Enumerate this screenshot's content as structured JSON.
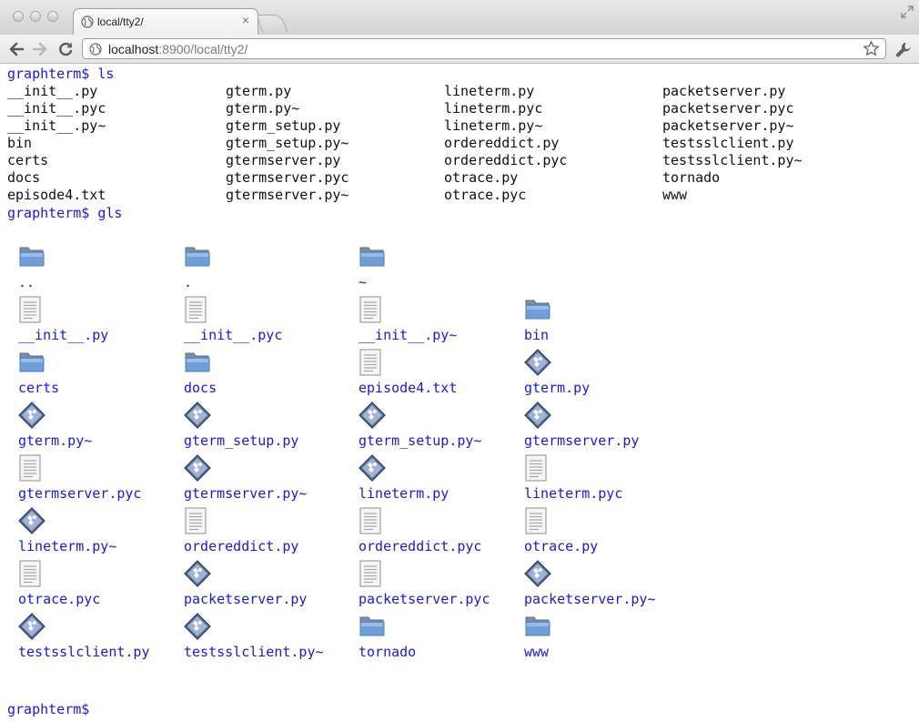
{
  "browser": {
    "tab_title": "local/tty2/",
    "url_host": "localhost",
    "url_path": ":8900/local/tty2/"
  },
  "terminal": {
    "prompt1": "graphterm$ ls",
    "ls_columns": [
      [
        "__init__.py",
        "__init__.pyc",
        "__init__.py~",
        "bin",
        "certs",
        "docs",
        "episode4.txt"
      ],
      [
        "gterm.py",
        "gterm.py~",
        "gterm_setup.py",
        "gterm_setup.py~",
        "gtermserver.py",
        "gtermserver.pyc",
        "gtermserver.py~"
      ],
      [
        "lineterm.py",
        "lineterm.pyc",
        "lineterm.py~",
        "ordereddict.py",
        "ordereddict.pyc",
        "otrace.py",
        "otrace.pyc"
      ],
      [
        "packetserver.py",
        "packetserver.pyc",
        "packetserver.py~",
        "testsslclient.py",
        "testsslclient.py~",
        "tornado",
        "www"
      ]
    ],
    "prompt2": "graphterm$ gls",
    "gls_rows": [
      [
        {
          "name": "..",
          "icon": "folder-icon"
        },
        {
          "name": ".",
          "icon": "folder-icon"
        },
        {
          "name": "~",
          "icon": "folder-icon"
        }
      ],
      [
        {
          "name": "__init__.py",
          "icon": "text-file-icon"
        },
        {
          "name": "__init__.pyc",
          "icon": "text-file-icon"
        },
        {
          "name": "__init__.py~",
          "icon": "text-file-icon"
        },
        {
          "name": "bin",
          "icon": "folder-icon"
        }
      ],
      [
        {
          "name": "certs",
          "icon": "folder-icon"
        },
        {
          "name": "docs",
          "icon": "folder-icon"
        },
        {
          "name": "episode4.txt",
          "icon": "text-file-icon"
        },
        {
          "name": "gterm.py",
          "icon": "script-icon"
        }
      ],
      [
        {
          "name": "gterm.py~",
          "icon": "script-icon"
        },
        {
          "name": "gterm_setup.py",
          "icon": "script-icon"
        },
        {
          "name": "gterm_setup.py~",
          "icon": "script-icon"
        },
        {
          "name": "gtermserver.py",
          "icon": "script-icon"
        }
      ],
      [
        {
          "name": "gtermserver.pyc",
          "icon": "text-file-icon"
        },
        {
          "name": "gtermserver.py~",
          "icon": "script-icon"
        },
        {
          "name": "lineterm.py",
          "icon": "script-icon"
        },
        {
          "name": "lineterm.pyc",
          "icon": "text-file-icon"
        }
      ],
      [
        {
          "name": "lineterm.py~",
          "icon": "script-icon"
        },
        {
          "name": "ordereddict.py",
          "icon": "text-file-icon"
        },
        {
          "name": "ordereddict.pyc",
          "icon": "text-file-icon"
        },
        {
          "name": "otrace.py",
          "icon": "text-file-icon"
        }
      ],
      [
        {
          "name": "otrace.pyc",
          "icon": "text-file-icon"
        },
        {
          "name": "packetserver.py",
          "icon": "script-icon"
        },
        {
          "name": "packetserver.pyc",
          "icon": "text-file-icon"
        },
        {
          "name": "packetserver.py~",
          "icon": "script-icon"
        }
      ],
      [
        {
          "name": "testsslclient.py",
          "icon": "script-icon"
        },
        {
          "name": "testsslclient.py~",
          "icon": "script-icon"
        },
        {
          "name": "tornado",
          "icon": "folder-icon"
        },
        {
          "name": "www",
          "icon": "folder-icon"
        }
      ]
    ],
    "prompt3": "graphterm$"
  },
  "colors": {
    "prompt": "#1a1ad6",
    "link": "#1a1ad6",
    "text": "#111111"
  }
}
